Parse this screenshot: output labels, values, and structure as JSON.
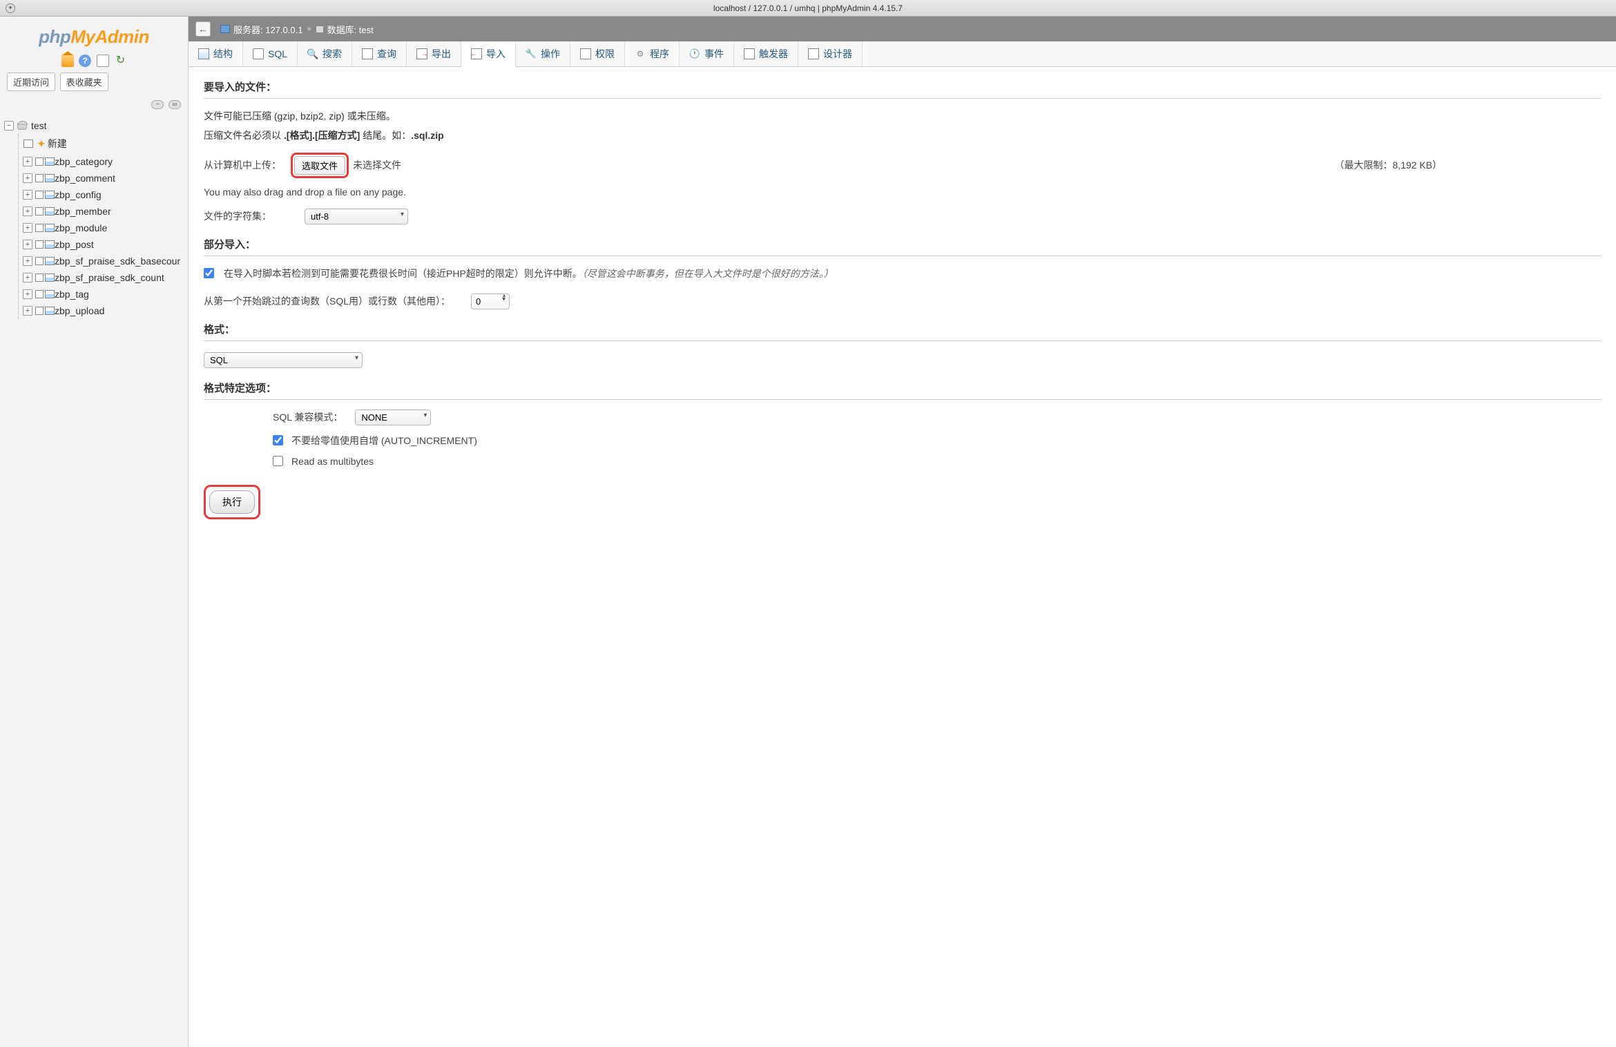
{
  "window": {
    "title": "localhost / 127.0.0.1 / umhq | phpMyAdmin 4.4.15.7"
  },
  "logo": {
    "p1": "php",
    "p2": "My",
    "p3": "Admin"
  },
  "sidebar": {
    "recent_label": "近期访问",
    "fav_label": "表收藏夹",
    "db_name": "test",
    "new_label": "新建",
    "tables": [
      "zbp_category",
      "zbp_comment",
      "zbp_config",
      "zbp_member",
      "zbp_module",
      "zbp_post",
      "zbp_sf_praise_sdk_basecour",
      "zbp_sf_praise_sdk_count",
      "zbp_tag",
      "zbp_upload"
    ]
  },
  "breadcrumb": {
    "server_label": "服务器: 127.0.0.1",
    "db_label": "数据库: test"
  },
  "tabs": [
    {
      "label": "结构"
    },
    {
      "label": "SQL"
    },
    {
      "label": "搜索"
    },
    {
      "label": "查询"
    },
    {
      "label": "导出"
    },
    {
      "label": "导入"
    },
    {
      "label": "操作"
    },
    {
      "label": "权限"
    },
    {
      "label": "程序"
    },
    {
      "label": "事件"
    },
    {
      "label": "触发器"
    },
    {
      "label": "设计器"
    }
  ],
  "import": {
    "section_file": "要导入的文件：",
    "comp_text": "文件可能已压缩 (gzip, bzip2, zip) 或未压缩。",
    "comp_text2a": "压缩文件名必须以 ",
    "comp_text2b": ".[格式].[压缩方式]",
    "comp_text2c": " 结尾。如：",
    "comp_text2d": ".sql.zip",
    "upload_label": "从计算机中上传：",
    "file_btn": "选取文件",
    "no_file": "未选择文件",
    "max_limit": "（最大限制：8,192 KB）",
    "drag_text": "You may also drag and drop a file on any page.",
    "charset_label": "文件的字符集：",
    "charset_value": "utf-8",
    "section_partial": "部分导入：",
    "partial_check_a": "在导入时脚本若检测到可能需要花费很长时间（接近PHP超时的限定）则允许中断。",
    "partial_check_b": "（尽管这会中断事务，但在导入大文件时是个很好的方法。）",
    "skip_label": "从第一个开始跳过的查询数（SQL用）或行数（其他用）：",
    "skip_value": "0",
    "section_format": "格式：",
    "format_value": "SQL",
    "section_opts": "格式特定选项：",
    "compat_label": "SQL 兼容模式：",
    "compat_value": "NONE",
    "autoinc_label": "不要给零值使用自增 (AUTO_INCREMENT)",
    "multibytes_label": "Read as multibytes",
    "exec_btn": "执行"
  }
}
